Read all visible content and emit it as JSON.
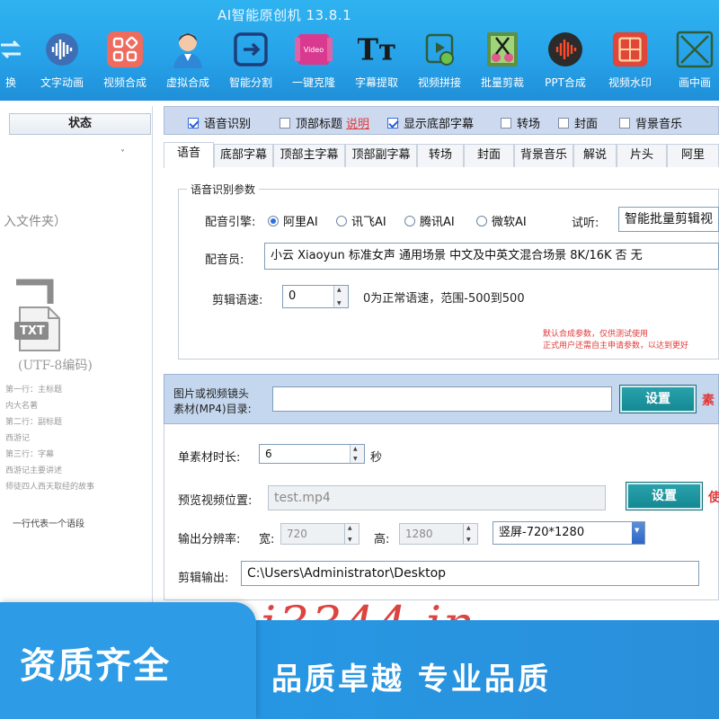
{
  "app": {
    "title": "AI智能原创机 13.8.1"
  },
  "toolbar": {
    "items": [
      {
        "label": "换",
        "icon": "swap-icon"
      },
      {
        "label": "文字动画",
        "icon": "audio-wave-icon"
      },
      {
        "label": "视频合成",
        "icon": "grid-apps-icon"
      },
      {
        "label": "虚拟合成",
        "icon": "avatar-icon"
      },
      {
        "label": "智能分割",
        "icon": "split-arrow-icon"
      },
      {
        "label": "一键克隆",
        "icon": "video-clone-icon"
      },
      {
        "label": "字幕提取",
        "icon": "text-tt-icon"
      },
      {
        "label": "视频拼接",
        "icon": "video-splice-icon"
      },
      {
        "label": "批量剪裁",
        "icon": "film-scissors-icon"
      },
      {
        "label": "PPT合成",
        "icon": "ppt-record-icon"
      },
      {
        "label": "视频水印",
        "icon": "watermark-icon"
      },
      {
        "label": "画中画",
        "icon": "pip-icon"
      }
    ],
    "colors": {
      "bar": "#27a3e9",
      "label": "#ffffff"
    }
  },
  "left_panel": {
    "status_header": "状态",
    "folder_text": "入文件夹）",
    "txt_icon_label": "TXT",
    "encoding_text": "(UTF-8编码)",
    "notes": [
      "第一行：主标题",
      "内大名著",
      "第二行：副标题",
      "西游记",
      "第三行：字幕",
      "西游记主要讲述",
      "师徒四人西天取经的故事"
    ],
    "one_line_note": "一行代表一个语段"
  },
  "options_bar": {
    "items": [
      {
        "label": "语音识别",
        "checked": true
      },
      {
        "label": "顶部标题",
        "checked": false,
        "link": "说明"
      },
      {
        "label": "显示底部字幕",
        "checked": true
      },
      {
        "label": "转场",
        "checked": false
      },
      {
        "label": "封面",
        "checked": false
      },
      {
        "label": "背景音乐",
        "checked": false
      }
    ]
  },
  "tabs": [
    {
      "label": "语音",
      "active": true
    },
    {
      "label": "底部字幕"
    },
    {
      "label": "顶部主字幕"
    },
    {
      "label": "顶部副字幕"
    },
    {
      "label": "转场"
    },
    {
      "label": "封面"
    },
    {
      "label": "背景音乐"
    },
    {
      "label": "解说"
    },
    {
      "label": "片头"
    },
    {
      "label": "阿里"
    }
  ],
  "speech": {
    "legend": "语音识别参数",
    "engine_label": "配音引擎:",
    "engines": [
      {
        "label": "阿里AI",
        "selected": true
      },
      {
        "label": "讯飞AI",
        "selected": false
      },
      {
        "label": "腾讯AI",
        "selected": false
      },
      {
        "label": "微软AI",
        "selected": false
      }
    ],
    "listen_label": "试听:",
    "listen_value": "智能批量剪辑视",
    "voice_label": "配音员:",
    "voice_value": "小云 Xiaoyun 标准女声 通用场景 中文及中英文混合场景 8K/16K 否 无",
    "speed_label": "剪辑语速:",
    "speed_value": "0",
    "speed_hint": "0为正常语速，范围-500到500",
    "note_line1": "默认合成参数，仅供测试使用",
    "note_line2": "正式用户还需自主申请参数，以达到更好"
  },
  "material": {
    "label_line1": "图片或视频镜头",
    "label_line2": "素材(MP4)目录:",
    "value": "",
    "button": "设置",
    "side_text": "素"
  },
  "settings": {
    "duration_label": "单素材时长:",
    "duration_value": "6",
    "duration_unit": "秒",
    "preview_label": "预览视频位置:",
    "preview_value": "test.mp4",
    "preview_button": "设置",
    "preview_side": "使",
    "resolution_label": "输出分辨率:",
    "width_label": "宽:",
    "width_value": "720",
    "height_label": "高:",
    "height_value": "1280",
    "orientation_value": "竖屏-720*1280",
    "output_label": "剪辑输出:",
    "output_value": "C:\\Users\\Administrator\\Desktop"
  },
  "watermark": "i3344 in",
  "banner": {
    "left_text": "资质齐全",
    "right_text": "品质卓越  专业品质",
    "colors": {
      "bg": "#2797e3",
      "text": "#ffffff"
    }
  }
}
